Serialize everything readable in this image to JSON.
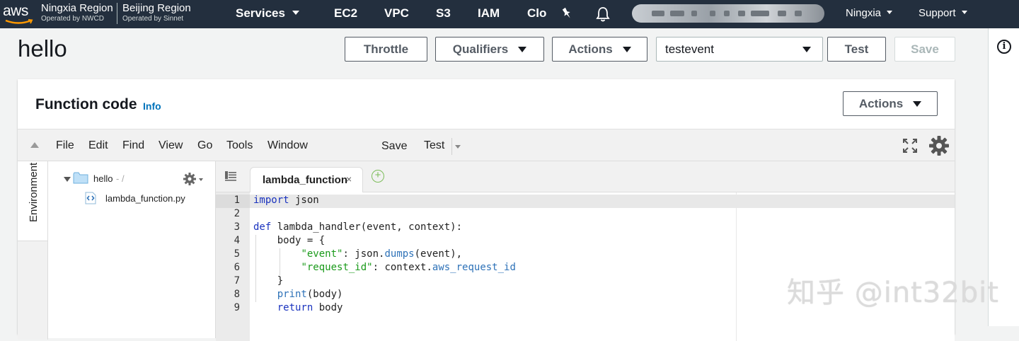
{
  "topnav": {
    "logo_text": "aws",
    "region1_name": "Ningxia Region",
    "region1_sub": "Operated by NWCD",
    "region2_name": "Beijing Region",
    "region2_sub": "Operated by Sinnet",
    "services_label": "Services",
    "shortcuts": [
      "EC2",
      "VPC",
      "S3",
      "IAM",
      "Clo"
    ],
    "region_label": "Ningxia",
    "support_label": "Support"
  },
  "header": {
    "title": "hello",
    "throttle_label": "Throttle",
    "qualifiers_label": "Qualifiers",
    "actions_label": "Actions",
    "test_event_selected": "testevent",
    "test_label": "Test",
    "save_label": "Save"
  },
  "function_code": {
    "title": "Function code",
    "info_label": "Info",
    "actions_label": "Actions"
  },
  "ide": {
    "menu": [
      "File",
      "Edit",
      "Find",
      "View",
      "Go",
      "Tools",
      "Window"
    ],
    "save_label": "Save",
    "test_label": "Test",
    "environment_tab": "Environment",
    "tree": {
      "folder": "hello",
      "folder_suffix": "- /",
      "file": "lambda_function.py"
    },
    "open_tab": "lambda_function",
    "tab_close": "×",
    "tab_add": "+",
    "line_numbers": [
      "1",
      "2",
      "3",
      "4",
      "5",
      "6",
      "7",
      "8",
      "9"
    ]
  },
  "code_lines": [
    "import json",
    "",
    "def lambda_handler(event, context):",
    "    body = {",
    "        \"event\": json.dumps(event),",
    "        \"request_id\": context.aws_request_id",
    "    }",
    "    print(body)",
    "    return body"
  ],
  "watermark": "知乎 @int32bit",
  "colors": {
    "nav_bg": "#232f3e",
    "link_blue": "#0073bb",
    "keyword": "#1a33bf",
    "string": "#1a9a1a",
    "builtin": "#2e72b8"
  }
}
